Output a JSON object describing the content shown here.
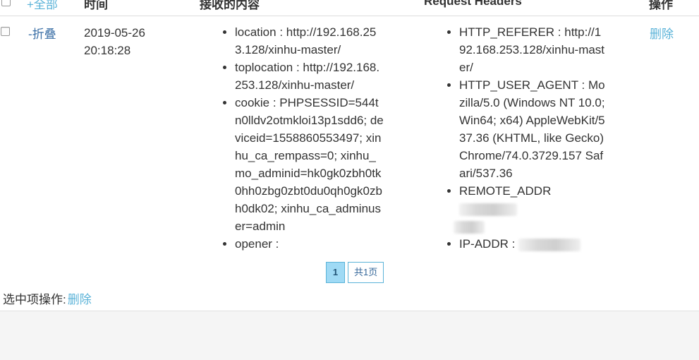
{
  "table": {
    "headers": {
      "expand_all": "+全部",
      "time": "时间",
      "received": "接收的内容",
      "request_headers": "Request Headers",
      "action": "操作"
    },
    "row": {
      "fold_label": "-折叠",
      "time_date": "2019-05-26",
      "time_clock": "20:18:28",
      "received_items": [
        "location : http://192.168.253.128/xinhu-master/",
        "toplocation : http://192.168.253.128/xinhu-master/",
        "cookie : PHPSESSID=544tn0lldv2otmkloi13p1sdd6; deviceid=1558860553497; xinhu_ca_rempass=0; xinhu_mo_adminid=hk0gk0zbh0tk0hh0zbg0zbt0du0qh0gk0zbh0dk02; xinhu_ca_adminuser=admin",
        "opener :"
      ],
      "header_items": [
        "HTTP_REFERER : http://192.168.253.128/xinhu-master/",
        "HTTP_USER_AGENT : Mozilla/5.0 (Windows NT 10.0; Win64; x64) AppleWebKit/537.36 (KHTML, like Gecko) Chrome/74.0.3729.157 Safari/537.36"
      ],
      "remote_addr_label": "REMOTE_ADDR",
      "ip_addr_label": "IP-ADDR :",
      "delete_label": "删除"
    }
  },
  "pager": {
    "current_page": "1",
    "total_label": "共1页"
  },
  "batch": {
    "label": "选中项操作:",
    "delete_label": "删除"
  },
  "colors": {
    "link": "#5bb3d8",
    "fold_link": "#3b6fa6",
    "active_page_bg": "#9fdaf5"
  }
}
